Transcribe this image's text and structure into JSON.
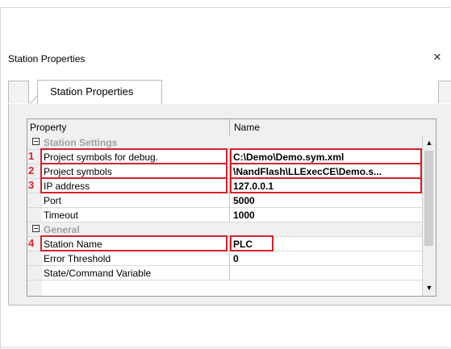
{
  "window": {
    "title": "Station Properties",
    "close_glyph": "×"
  },
  "tab": {
    "label": "Station Properties"
  },
  "grid": {
    "headers": [
      "Property",
      "Name"
    ],
    "rows": [
      {
        "kind": "category",
        "label": "Station Settings"
      },
      {
        "kind": "prop",
        "marker": "1",
        "label": "Project symbols for debug.",
        "value": "C:\\Demo\\Demo.sym.xml"
      },
      {
        "kind": "prop",
        "marker": "2",
        "label": "Project symbols",
        "value": "\\NandFlash\\LLExecCE\\Demo.s..."
      },
      {
        "kind": "prop",
        "marker": "3",
        "label": "IP address",
        "value": "127.0.0.1"
      },
      {
        "kind": "prop",
        "label": "Port",
        "value": "5000"
      },
      {
        "kind": "prop",
        "label": "Timeout",
        "value": "1000"
      },
      {
        "kind": "category",
        "label": "General"
      },
      {
        "kind": "prop",
        "marker": "4",
        "label": "Station Name",
        "value": "PLC"
      },
      {
        "kind": "prop",
        "label": "Error Threshold",
        "value": "0"
      },
      {
        "kind": "prop",
        "label": "State/Command Variable",
        "value": ""
      }
    ]
  },
  "scrollbar": {
    "up_glyph": "▲",
    "down_glyph": "▼"
  },
  "colors": {
    "highlight": "#d8212a"
  }
}
